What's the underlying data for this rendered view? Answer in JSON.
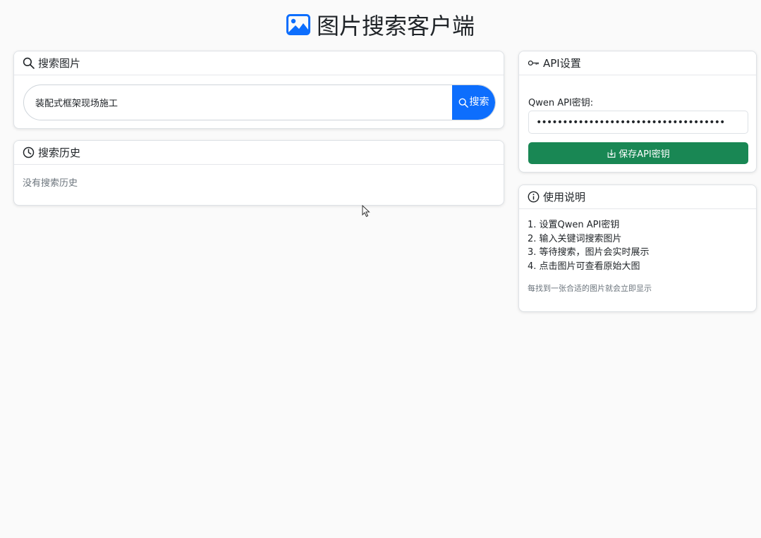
{
  "app": {
    "title": "图片搜索客户端"
  },
  "search": {
    "header": "搜索图片",
    "input_value": "装配式框架现场施工",
    "button_label": "搜索"
  },
  "history": {
    "header": "搜索历史",
    "empty_text": "没有搜索历史"
  },
  "api": {
    "header": "API设置",
    "key_label": "Qwen API密钥:",
    "key_value": "••••••••••••••••••••••••••••••••••••",
    "save_label": "保存API密钥"
  },
  "usage": {
    "header": "使用说明",
    "steps": [
      "1. 设置Qwen API密钥",
      "2. 输入关键词搜索图片",
      "3. 等待搜索，图片会实时展示",
      "4. 点击图片可查看原始大图"
    ],
    "note": "每找到一张合适的图片就会立即显示"
  },
  "colors": {
    "primary": "#0d6efd",
    "success": "#198754",
    "muted": "#6c757d"
  }
}
